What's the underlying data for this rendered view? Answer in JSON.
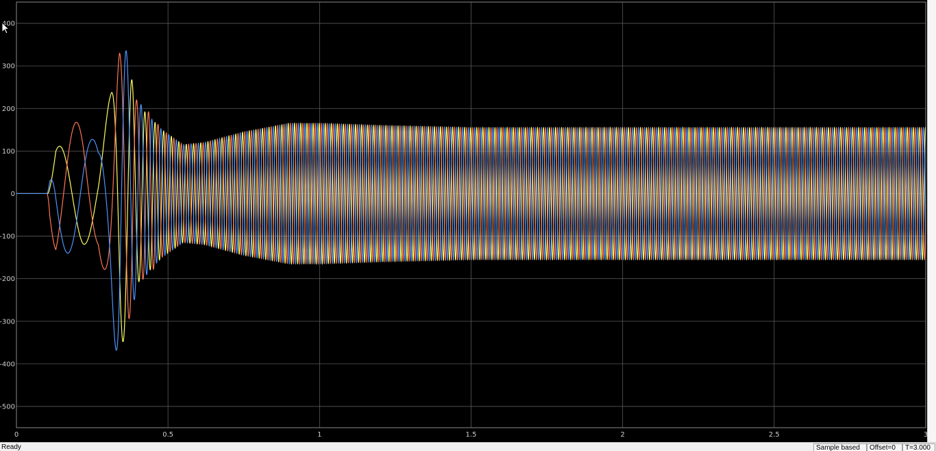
{
  "chart_data": {
    "type": "line",
    "title": "",
    "xlabel": "",
    "ylabel": "",
    "xlim": [
      0,
      3
    ],
    "ylim": [
      -550,
      450
    ],
    "xticks": [
      0,
      0.5,
      1,
      1.5,
      2,
      2.5,
      3
    ],
    "xtick_labels": [
      "0",
      "0.5",
      "1",
      "1.5",
      "2",
      "2.5",
      "3"
    ],
    "yticks": [
      -500,
      -400,
      -300,
      -200,
      -100,
      0,
      100,
      200,
      300,
      400
    ],
    "ytick_labels": [
      "-500",
      "-400",
      "-300",
      "-200",
      "-100",
      "0",
      "100",
      "200",
      "300",
      "400"
    ],
    "grid": true,
    "background": "#000000",
    "frequency_hz": 50,
    "series": [
      {
        "color": "#ffff66",
        "envelope": {
          "t": [
            0.1,
            0.13,
            0.22,
            0.27,
            0.31,
            0.34,
            0.37,
            0.4,
            0.44,
            0.48,
            0.55,
            0.62,
            0.75,
            0.9,
            1.0,
            1.2,
            1.5,
            3.0
          ],
          "v": [
            0,
            110,
            120,
            110,
            230,
            380,
            300,
            210,
            180,
            150,
            115,
            120,
            145,
            165,
            165,
            160,
            155,
            155
          ]
        }
      },
      {
        "color": "#ff7755",
        "envelope": {
          "t": [
            0.1,
            0.13,
            0.22,
            0.27,
            0.31,
            0.34,
            0.37,
            0.4,
            0.44,
            0.48,
            0.55,
            0.62,
            0.75,
            0.9,
            1.0,
            1.2,
            1.5,
            3.0
          ],
          "v": [
            0,
            160,
            170,
            130,
            250,
            330,
            300,
            210,
            190,
            150,
            115,
            120,
            145,
            165,
            165,
            160,
            155,
            155
          ]
        }
      },
      {
        "color": "#4d94ff",
        "envelope": {
          "t": [
            0.1,
            0.13,
            0.22,
            0.27,
            0.31,
            0.34,
            0.37,
            0.4,
            0.44,
            0.48,
            0.55,
            0.62,
            0.75,
            0.9,
            1.0,
            1.2,
            1.5,
            3.0
          ],
          "v": [
            0,
            140,
            140,
            120,
            260,
            440,
            300,
            220,
            180,
            150,
            115,
            120,
            145,
            165,
            165,
            160,
            155,
            155
          ]
        }
      }
    ]
  },
  "statusbar": {
    "status": "Ready",
    "sample": "Sample based",
    "offset": "Offset=0",
    "time": "T=3.000"
  }
}
